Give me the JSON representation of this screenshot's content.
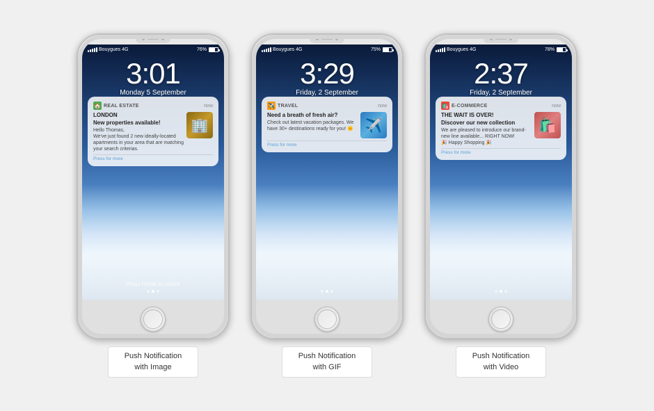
{
  "phones": [
    {
      "id": "phone-1",
      "status": {
        "carrier": "Bouygues",
        "network": "4G",
        "battery": "76%",
        "batteryPct": 76
      },
      "time": "3:01",
      "date": "Monday 5 September",
      "notification": {
        "app_icon": "🏠",
        "app_icon_class": "icon-realestate",
        "app_name": "REAL ESTATE",
        "time": "now",
        "title": "LONDON",
        "subtitle": "New properties available!",
        "message": "Hello Thomas,\nWe've just found 2 new ideally-located apartments in your area that are matching your search criterias.",
        "press_more": "Press for more",
        "image_emoji": "🏢"
      },
      "press_home": "Press Home to unlock",
      "caption": "Push Notification\nwith Image"
    },
    {
      "id": "phone-2",
      "status": {
        "carrier": "Bouygues",
        "network": "4G",
        "battery": "75%",
        "batteryPct": 75
      },
      "time": "3:29",
      "date": "Friday, 2 September",
      "notification": {
        "app_icon": "✈️",
        "app_icon_class": "icon-travel",
        "app_name": "TRAVEL",
        "time": "now",
        "title": "Need a breath of fresh air?",
        "subtitle": "",
        "message": "Check out latest vacation packages. We have 30+ destinations ready for you! 🌞",
        "press_more": "Press for more",
        "image_emoji": "✈️"
      },
      "press_home": "",
      "caption": "Push Notification\nwith GIF"
    },
    {
      "id": "phone-3",
      "status": {
        "carrier": "Bouygues",
        "network": "4G",
        "battery": "78%",
        "batteryPct": 78
      },
      "time": "2:37",
      "date": "Friday, 2 September",
      "notification": {
        "app_icon": "🛍️",
        "app_icon_class": "icon-ecommerce",
        "app_name": "E-COMMERCE",
        "time": "now",
        "title": "THE WAIT IS OVER!",
        "subtitle": "Discover our new collection",
        "message": "We are pleased to introduce our brand-new line available... RIGHT NOW!\n🎉 Happy Shopping 🎉",
        "press_more": "Press for more",
        "image_emoji": "🛍️"
      },
      "press_home": "",
      "caption": "Push Notification\nwith Video"
    }
  ]
}
